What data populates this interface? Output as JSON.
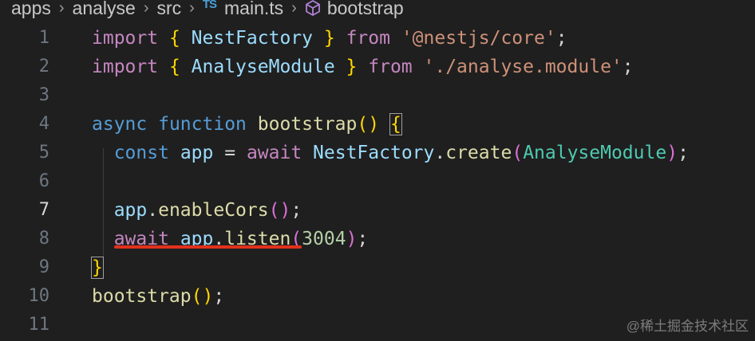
{
  "breadcrumb": {
    "items": [
      "apps",
      "analyse",
      "src",
      "main.ts",
      "bootstrap"
    ],
    "ts_badge": "TS",
    "separator": "›"
  },
  "editor": {
    "active_line": 7,
    "lines": [
      {
        "number": "1"
      },
      {
        "number": "2"
      },
      {
        "number": "3"
      },
      {
        "number": "4"
      },
      {
        "number": "5"
      },
      {
        "number": "6"
      },
      {
        "number": "7"
      },
      {
        "number": "8"
      },
      {
        "number": "9"
      },
      {
        "number": "10"
      },
      {
        "number": "11"
      }
    ],
    "tokens": {
      "l1": {
        "import": "import",
        "ob": "{",
        "name": "NestFactory",
        "cb": "}",
        "from": "from",
        "str": "'@nestjs/core'",
        "semi": ";"
      },
      "l2": {
        "import": "import",
        "ob": "{",
        "name": "AnalyseModule",
        "cb": "}",
        "from": "from",
        "str": "'./analyse.module'",
        "semi": ";"
      },
      "l4": {
        "async": "async",
        "function": "function",
        "name": "bootstrap",
        "parens": "()",
        "ob": "{"
      },
      "l5": {
        "const": "const",
        "app": "app",
        "eq": "=",
        "await": "await",
        "cls": "NestFactory",
        "dot": ".",
        "method": "create",
        "op": "(",
        "arg": "AnalyseModule",
        "cp": ")",
        "semi": ";"
      },
      "l7": {
        "app": "app",
        "dot": ".",
        "method": "enableCors",
        "op": "(",
        "cp": ")",
        "semi": ";"
      },
      "l8": {
        "await": "await",
        "app": "app",
        "dot": ".",
        "method": "listen",
        "op": "(",
        "num": "3004",
        "cp": ")",
        "semi": ";"
      },
      "l9": {
        "cb": "}"
      },
      "l10": {
        "name": "bootstrap",
        "parens": "()",
        "semi": ";"
      }
    }
  },
  "watermark": "@稀土掘金技术社区",
  "colors": {
    "background": "#1f1f1f",
    "keyword_control": "#c586c0",
    "keyword": "#569cd6",
    "variable": "#9cdcfe",
    "function": "#dcdcaa",
    "class": "#4ec9b0",
    "string": "#ce9178",
    "number": "#b5cea8",
    "bracket_level1": "#ffd700",
    "bracket_level2": "#da70d6",
    "annotation_underline": "#e0311c"
  },
  "icons": {
    "breadcrumb_separator": "chevron-right-icon",
    "file_type": "typescript-icon",
    "symbol": "cube-icon"
  }
}
